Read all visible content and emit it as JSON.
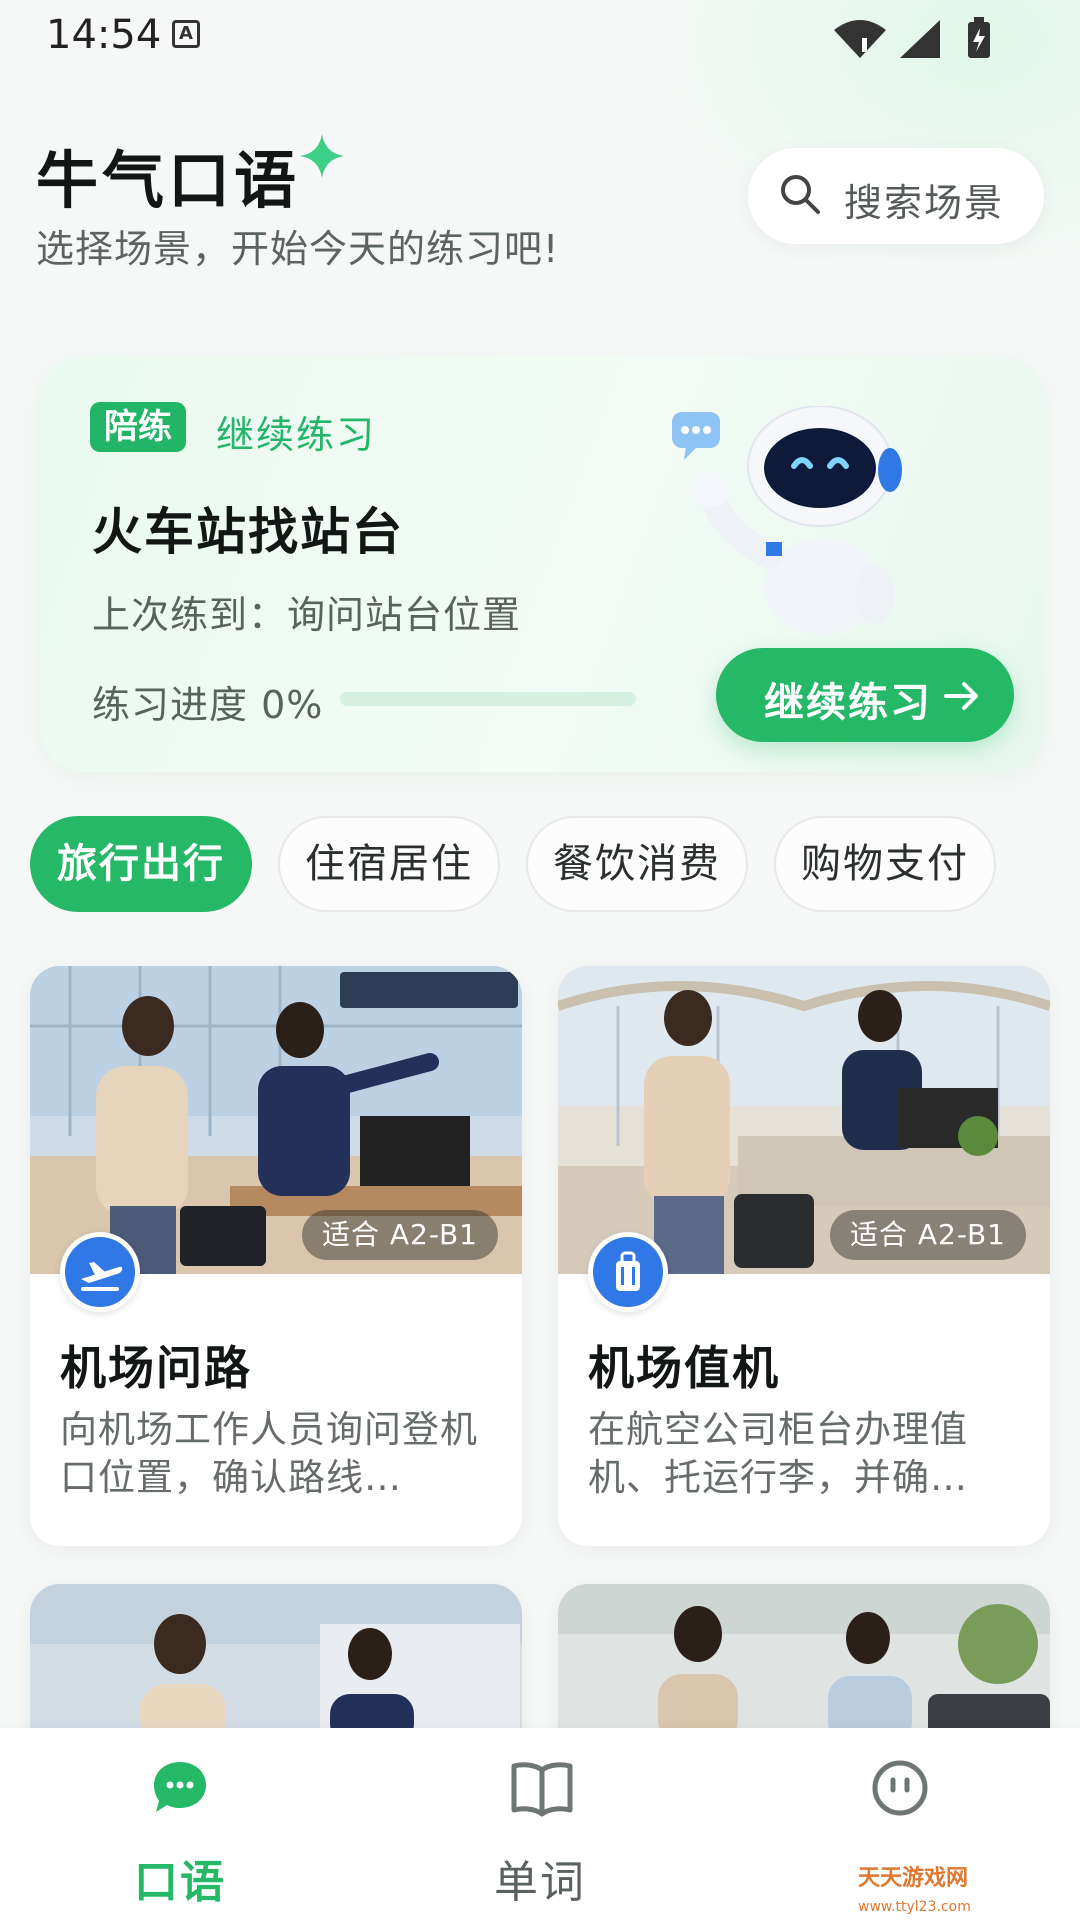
{
  "status_bar": {
    "time": "14:54",
    "a_icon": "A"
  },
  "header": {
    "title": "牛气口语",
    "subtitle": "选择场景，开始今天的练习吧!",
    "search_placeholder": "搜索场景"
  },
  "continue_card": {
    "tag": "陪练",
    "tag_text": "继续练习",
    "title": "火车站找站台",
    "last_practice": "上次练到：询问站台位置",
    "progress_label": "练习进度 0%",
    "progress": 0,
    "button_label": "继续练习"
  },
  "tabs": [
    {
      "label": "旅行出行",
      "active": true
    },
    {
      "label": "住宿居住",
      "active": false
    },
    {
      "label": "餐饮消费",
      "active": false
    },
    {
      "label": "购物支付",
      "active": false
    }
  ],
  "scenes": [
    {
      "title": "机场问路",
      "desc": "向机场工作人员询问登机口位置，确认路线…",
      "level": "适合 A2-B1",
      "icon": "airplane-takeoff-icon"
    },
    {
      "title": "机场值机",
      "desc": "在航空公司柜台办理值机、托运行李，并确…",
      "level": "适合 A2-B1",
      "icon": "luggage-icon"
    }
  ],
  "bottom_nav": [
    {
      "label": "口语",
      "icon": "chat-bubble-icon",
      "active": true
    },
    {
      "label": "单词",
      "icon": "book-icon",
      "active": false
    },
    {
      "label": "",
      "icon": "profile-face-icon",
      "active": false
    }
  ],
  "watermark": {
    "text": "天天游戏网",
    "url": "www.ttyl23.com"
  },
  "colors": {
    "accent": "#24b867",
    "scene_icon": "#2f78e6",
    "text_dark": "#121614"
  }
}
